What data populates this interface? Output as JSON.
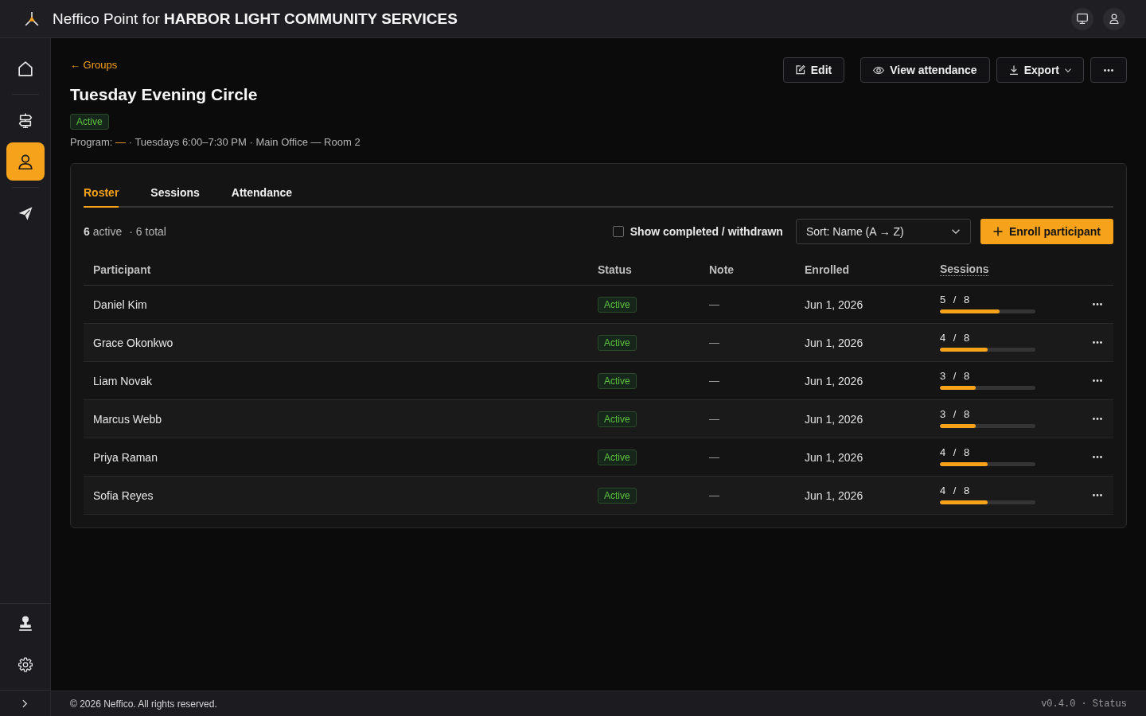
{
  "header": {
    "title": "Neffico Point for **HARBOR LIGHT COMMUNITY SERVICES**"
  },
  "sidebar": {
    "nav_items": [
      {
        "selected": false
      },
      {
        "selected": false
      },
      {
        "selected": true
      },
      {
        "selected": false
      }
    ]
  },
  "breadcrumb": {
    "back_link": "← Groups"
  },
  "group": {
    "title": "Tuesday Evening Circle",
    "status": "Active",
    "meta": {
      "label": "Program:",
      "program": "—",
      "schedule": "· Tuesdays 6:00–7:30 PM · Main Office — Room 2"
    }
  },
  "actions": {
    "edit": "Edit",
    "view_attendance": "View attendance",
    "export": "Export"
  },
  "tabs": [
    {
      "label": "Roster",
      "selected": true
    },
    {
      "label": "Sessions",
      "selected": false
    },
    {
      "label": "Attendance",
      "selected": false
    }
  ],
  "roster": {
    "summary": "**6** active",
    "total": "· 6 total",
    "show_completed": {
      "label": "Show completed / withdrawn",
      "checked": false
    },
    "sort": {
      "value": "Sort: Name (A → Z)"
    },
    "enroll_button": "Enroll participant"
  },
  "table": {
    "columns": [
      {
        "label": "Participant",
        "has_tooltip": false
      },
      {
        "label": "Status",
        "has_tooltip": false
      },
      {
        "label": "Note",
        "has_tooltip": false
      },
      {
        "label": "Enrolled",
        "has_tooltip": false
      },
      {
        "label": "Sessions",
        "has_tooltip": true
      }
    ],
    "rows": [
      {
        "participant": "Daniel Kim",
        "status": "Active",
        "note": "—",
        "enrolled": "Jun 1, 2026",
        "sessions": "5 / 8",
        "level": 0.625
      },
      {
        "participant": "Grace Okonkwo",
        "status": "Active",
        "note": "—",
        "enrolled": "Jun 1, 2026",
        "sessions": "4 / 8",
        "level": 0.5
      },
      {
        "participant": "Liam Novak",
        "status": "Active",
        "note": "—",
        "enrolled": "Jun 1, 2026",
        "sessions": "3 / 8",
        "level": 0.375
      },
      {
        "participant": "Marcus Webb",
        "status": "Active",
        "note": "—",
        "enrolled": "Jun 1, 2026",
        "sessions": "3 / 8",
        "level": 0.375
      },
      {
        "participant": "Priya Raman",
        "status": "Active",
        "note": "—",
        "enrolled": "Jun 1, 2026",
        "sessions": "4 / 8",
        "level": 0.5
      },
      {
        "participant": "Sofia Reyes",
        "status": "Active",
        "note": "—",
        "enrolled": "Jun 1, 2026",
        "sessions": "4 / 8",
        "level": 0.5
      }
    ]
  },
  "footer": {
    "copyright": "© 2026 Neffico. All rights reserved.",
    "version": "v0.4.0 ·",
    "status_link": "Status"
  }
}
